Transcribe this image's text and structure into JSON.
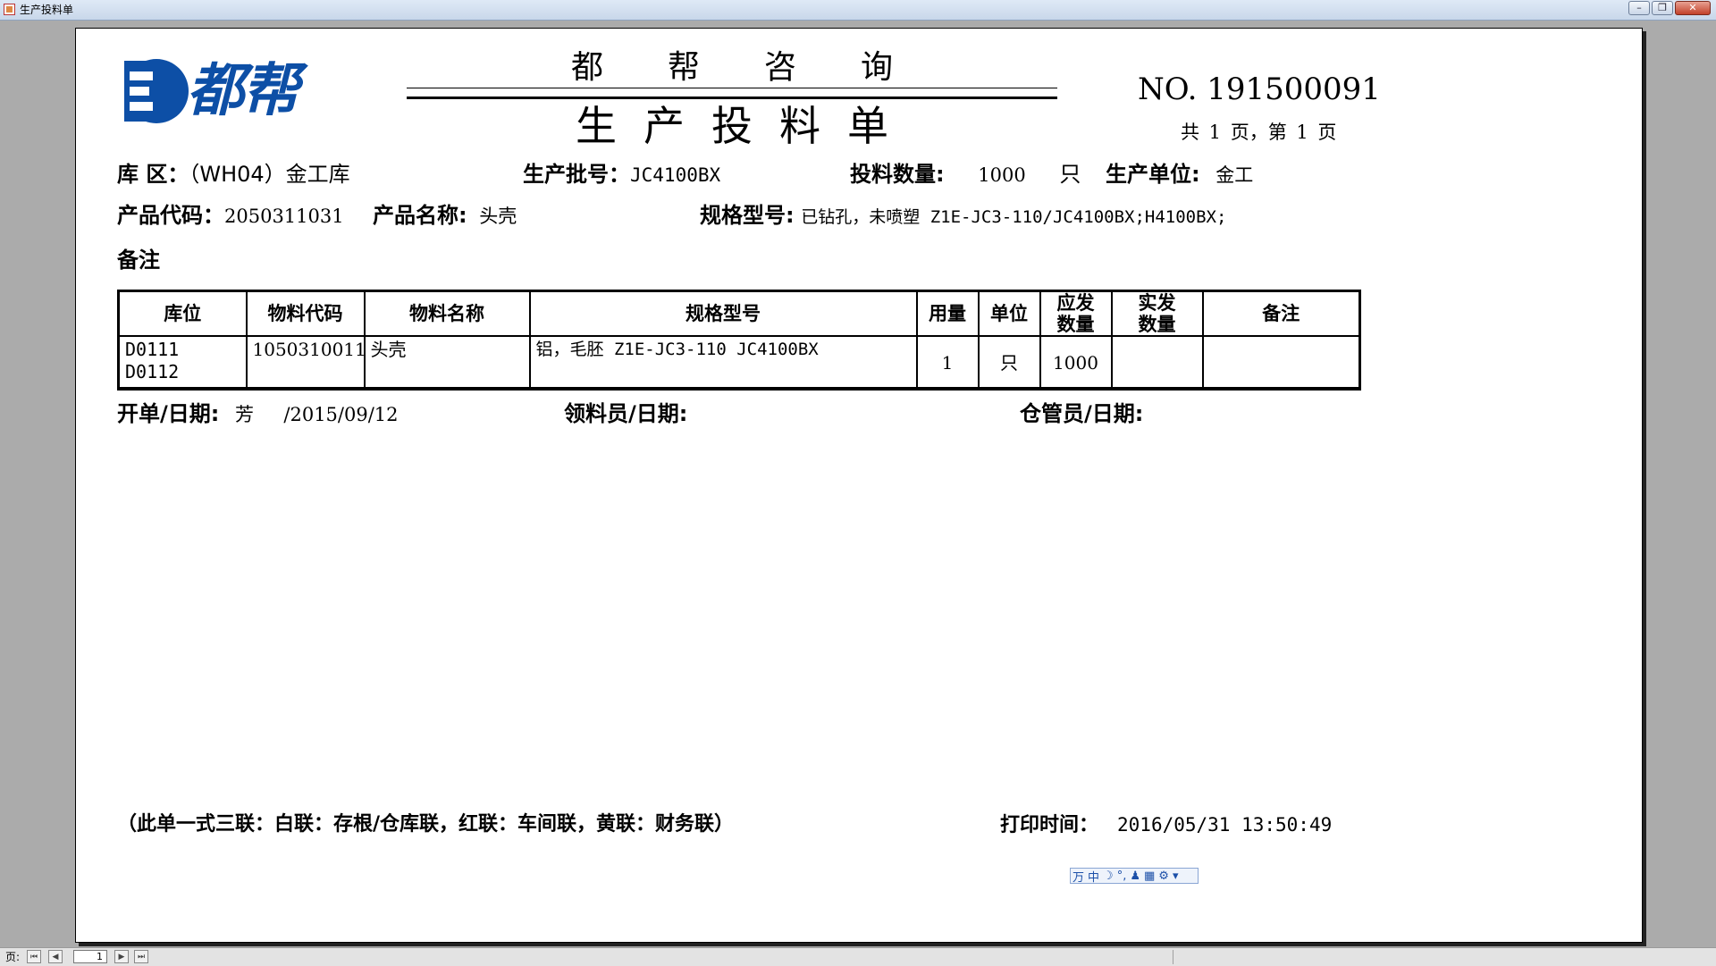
{
  "window": {
    "title": "生产投料单",
    "minimize": "–",
    "restore": "❐",
    "close": "✕"
  },
  "header": {
    "logo_text": "都帮",
    "company": "都帮咨询",
    "doc_title": "生产投料单",
    "doc_no": "NO. 191500091",
    "page_info": "共 1 页，第 1 页"
  },
  "fields": {
    "warehouse_label": "库 区：",
    "warehouse_value": "（WH04）金工库",
    "batch_label": "生产批号：",
    "batch_value": "JC4100BX",
    "qty_label": "投料数量:",
    "qty_value": "1000",
    "qty_unit": "只",
    "unit_label": "生产单位:",
    "unit_value": "金工",
    "product_code_label": "产品代码：",
    "product_code_value": "2050311031",
    "product_name_label": "产品名称:",
    "product_name_value": "头壳",
    "spec_label": "规格型号:",
    "spec_value": "已钻孔，未喷塑 Z1E-JC3-110/JC4100BX;H4100BX;",
    "remark_label": "备注"
  },
  "table": {
    "headers": [
      "库位",
      "物料代码",
      "物料名称",
      "规格型号",
      "用量",
      "单位",
      "应发\n数量",
      "实发\n数量",
      "备注"
    ],
    "rows": [
      {
        "location": "D0111\nD0112",
        "code": "1050310011",
        "name": "头壳",
        "spec": "铝，毛胚 Z1E-JC3-110 JC4100BX",
        "usage": "1",
        "unit": "只",
        "due_qty": "1000",
        "actual_qty": "",
        "remark": ""
      }
    ]
  },
  "signatures": {
    "issuer_label": "开单/日期:",
    "issuer_value": "芳     /2015/09/12",
    "picker_label": "领料员/日期:",
    "keeper_label": "仓管员/日期:"
  },
  "footer": {
    "note": "（此单一式三联：白联：存根/仓库联，红联：车间联，黄联：财务联）",
    "print_label": "打印时间：",
    "print_value": "2016/05/31 13:50:49"
  },
  "ime_bar": [
    "万",
    "中",
    "☽",
    "°,",
    "♟",
    "▦",
    "⚙",
    "▾"
  ],
  "nav": {
    "page_label": "页:",
    "first": "⏮",
    "prev": "◀",
    "page_value": "1",
    "next": "▶",
    "last": "⏭"
  }
}
